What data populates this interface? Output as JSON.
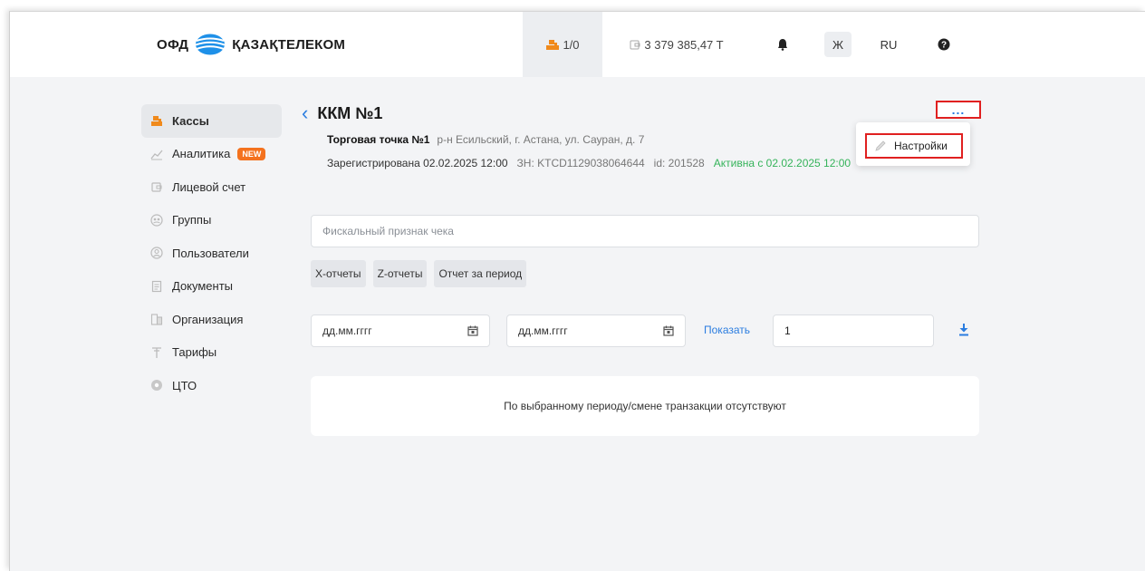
{
  "header": {
    "logo_prefix": "ОФД",
    "logo_name": "ҚАЗАҚТЕЛЕКОМ",
    "kkm_count": "1/0",
    "balance": "3 379 385,47 T",
    "lang_kz": "Ж",
    "lang_current": "RU"
  },
  "sidebar": {
    "items": [
      {
        "label": "Кассы",
        "icon": "cash-register-icon"
      },
      {
        "label": "Аналитика",
        "icon": "chart-icon",
        "badge": "NEW"
      },
      {
        "label": "Лицевой счет",
        "icon": "wallet-icon"
      },
      {
        "label": "Группы",
        "icon": "group-icon"
      },
      {
        "label": "Пользователи",
        "icon": "user-icon"
      },
      {
        "label": "Документы",
        "icon": "document-icon"
      },
      {
        "label": "Организация",
        "icon": "building-icon"
      },
      {
        "label": "Тарифы",
        "icon": "tariff-icon"
      },
      {
        "label": "ЦТО",
        "icon": "service-icon"
      }
    ]
  },
  "main": {
    "title": "ККМ №1",
    "more_label": "...",
    "point_name": "Торговая точка №1",
    "point_address": "р-н Есильский, г. Астана, ул. Сауран, д. 7",
    "registered": "Зарегистрирована 02.02.2025 12:00",
    "serial": "ЗН: KTCD1129038064644",
    "id_text": "id: 201528",
    "active_since": "Активна с 02.02.2025 12:00",
    "menu": {
      "settings_label": "Настройки"
    },
    "search_placeholder": "Фискальный признак чека",
    "tabs": [
      "X-отчеты",
      "Z-отчеты",
      "Отчет за период"
    ],
    "date_from_placeholder": "дд.мм.гггг",
    "date_to_placeholder": "дд.мм.гггг",
    "show_label": "Показать",
    "shift_value": "1",
    "empty_message": "По выбранному периоду/смене транзакции отсутствуют"
  },
  "colors": {
    "accent": "#2b7de0",
    "highlight": "#e02020",
    "active_green": "#35b35a",
    "badge_orange": "#f4721e"
  }
}
